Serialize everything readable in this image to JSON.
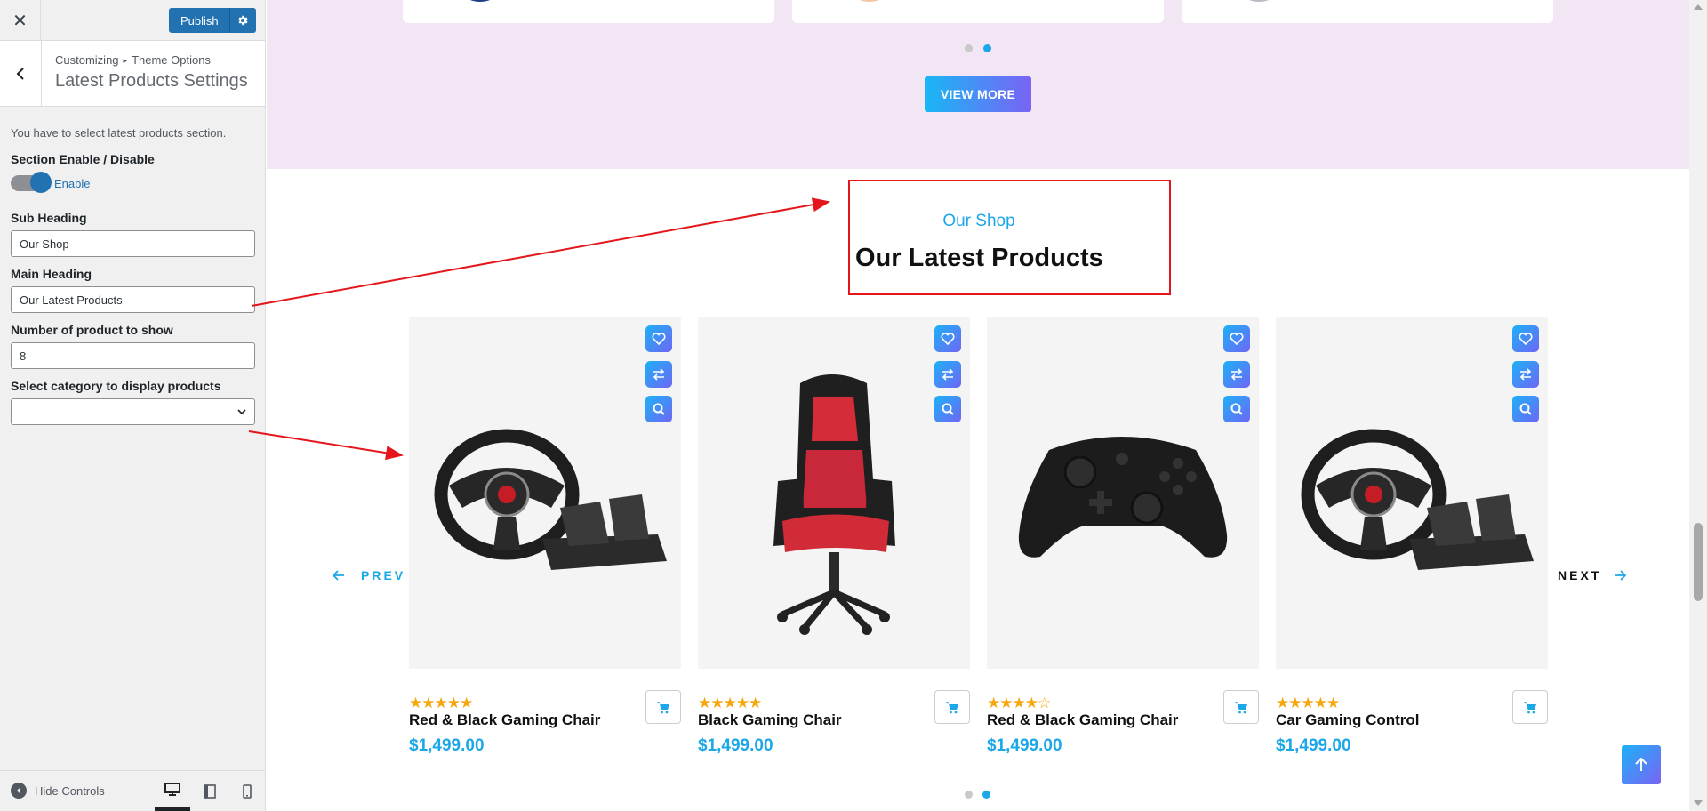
{
  "sidebar": {
    "close_label": "✕",
    "publish_label": "Publish",
    "breadcrumb": {
      "root": "Customizing",
      "separator": "▸",
      "section": "Theme Options"
    },
    "panel_title": "Latest Products Settings",
    "description": "You have to select latest products section.",
    "toggle": {
      "label": "Section Enable / Disable",
      "state_label": "Enable",
      "enabled": true
    },
    "sub_heading": {
      "label": "Sub Heading",
      "value": "Our Shop"
    },
    "main_heading": {
      "label": "Main Heading",
      "value": "Our Latest Products"
    },
    "product_count": {
      "label": "Number of product to show",
      "value": "8"
    },
    "category": {
      "label": "Select category to display products",
      "value": ""
    },
    "footer": {
      "hide_controls": "Hide Controls"
    }
  },
  "preview": {
    "view_more": "VIEW MORE",
    "sub_heading": "Our Shop",
    "main_heading": "Our Latest Products",
    "prev": "PREV",
    "next": "NEXT",
    "products": [
      {
        "title": "Red & Black Gaming Chair",
        "price": "$1,499.00",
        "stars": "★★★★★",
        "rating": 5,
        "image": "steering-wheel"
      },
      {
        "title": "Black Gaming Chair",
        "price": "$1,499.00",
        "stars": "★★★★★",
        "rating": 5,
        "image": "gaming-chair"
      },
      {
        "title": "Red & Black Gaming Chair",
        "price": "$1,499.00",
        "stars": "★★★★☆",
        "rating": 4,
        "image": "game-controller"
      },
      {
        "title": "Car Gaming Control",
        "price": "$1,499.00",
        "stars": "★★★★★",
        "rating": 5,
        "image": "steering-wheel"
      }
    ],
    "carousel_active_dot": 2
  },
  "colors": {
    "accent": "#1ba7e8",
    "wp_blue": "#2271b1",
    "highlight": "#e4161b",
    "band": "#f2e6f4",
    "star": "#f6a70d"
  }
}
